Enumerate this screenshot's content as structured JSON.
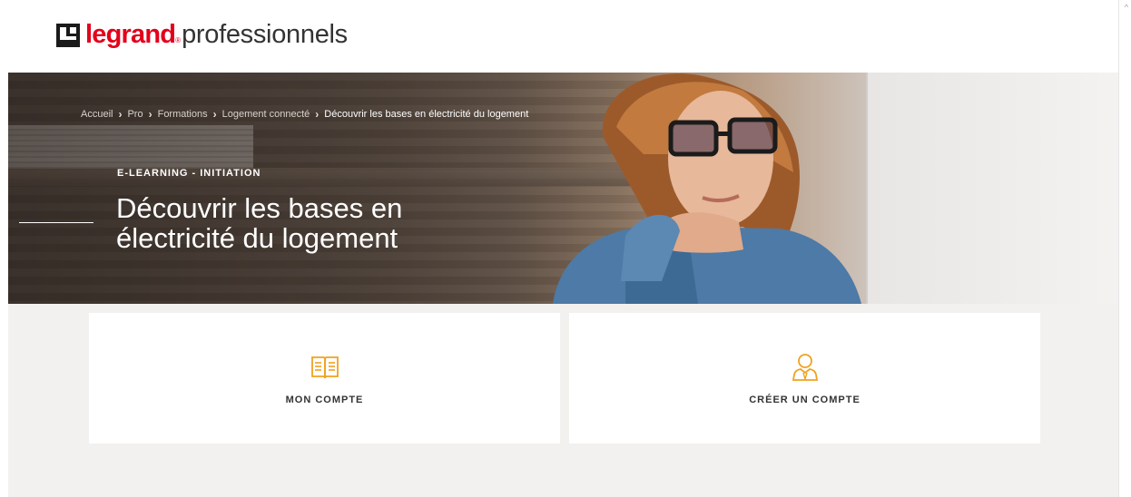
{
  "header": {
    "brand": "legrand",
    "brand_reg": "®",
    "sub": "professionnels"
  },
  "breadcrumb": {
    "items": [
      "Accueil",
      "Pro",
      "Formations",
      "Logement connecté"
    ],
    "current": "Découvrir les bases en électricité du logement",
    "separator": "›"
  },
  "hero": {
    "kicker": "E-LEARNING - INITIATION",
    "title": "Découvrir les bases en électricité du logement"
  },
  "cards": [
    {
      "label": "MON COMPTE",
      "icon": "book-icon"
    },
    {
      "label": "CRÉER UN COMPTE",
      "icon": "user-icon"
    }
  ],
  "colors": {
    "brand_red": "#e3001b",
    "accent_orange": "#f0a21f",
    "content_bg": "#f2f1ef"
  },
  "scrollbar": {
    "arrow": "^"
  }
}
